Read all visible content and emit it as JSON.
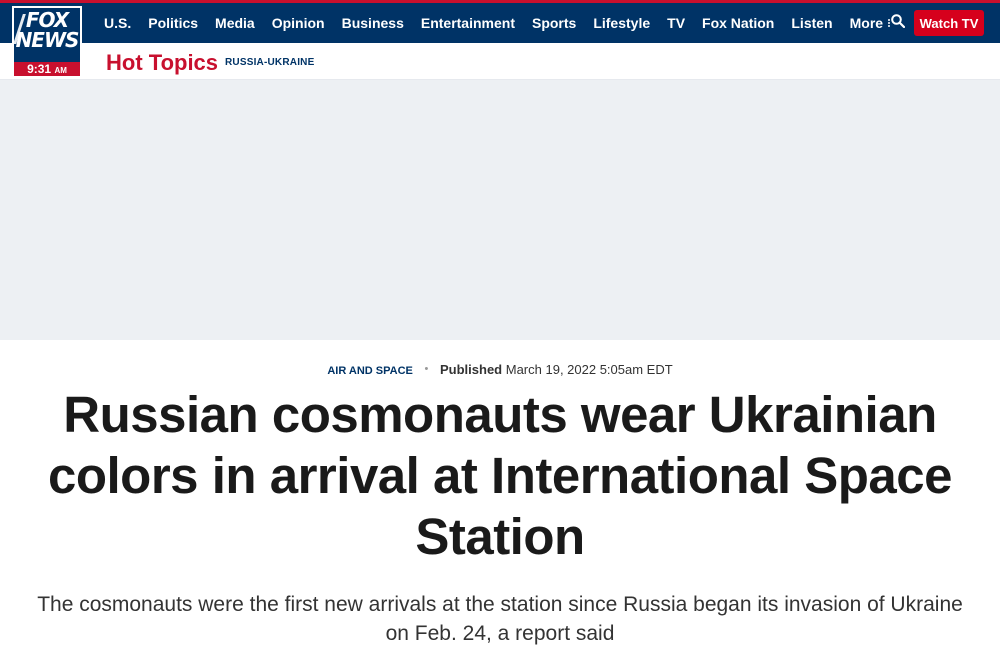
{
  "brand": {
    "logo_top": "FOX",
    "logo_bottom": "NEWS",
    "time": "9:31",
    "ampm": "AM"
  },
  "nav": {
    "items": [
      "U.S.",
      "Politics",
      "Media",
      "Opinion",
      "Business",
      "Entertainment",
      "Sports",
      "Lifestyle",
      "TV",
      "Fox Nation",
      "Listen"
    ],
    "more_label": "More",
    "watch_label": "Watch TV"
  },
  "hot_topics": {
    "label": "Hot Topics",
    "links": [
      "RUSSIA-UKRAINE"
    ]
  },
  "article": {
    "category": "AIR AND SPACE",
    "published_label": "Published",
    "published_date": "March 19, 2022 5:05am EDT",
    "headline": "Russian cosmonauts wear Ukrainian colors in arrival at International Space Station",
    "subheadline": "The cosmonauts were the first new arrivals at the station since Russia began its invasion of Ukraine on Feb. 24, a report said"
  },
  "icons": {
    "search": "search-icon",
    "more": "kebab-menu-icon"
  },
  "colors": {
    "nav_bg": "#003366",
    "accent_red": "#c8102e",
    "watch_btn": "#d6001c",
    "ad_bg": "#edf0f3"
  }
}
